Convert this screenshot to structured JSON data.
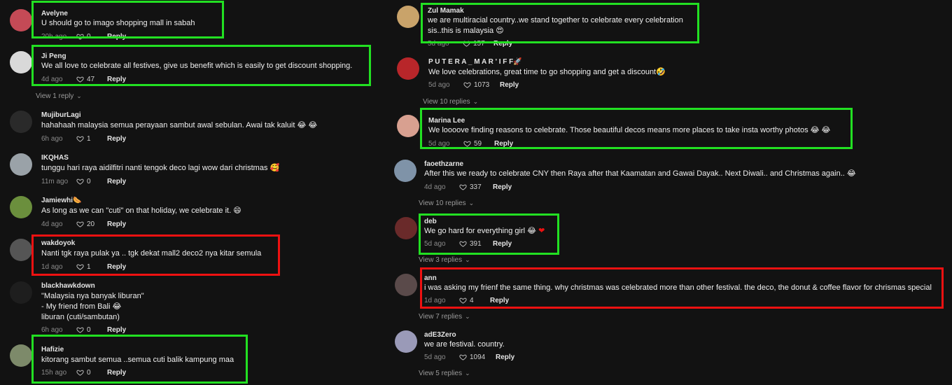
{
  "left": [
    {
      "user": "Avelyne",
      "text": "U should go to imago shopping mall in sabah",
      "time": "20h ago",
      "likes": "0",
      "reply": "Reply",
      "avatar": "#c44a56"
    },
    {
      "user": "Ji Peng",
      "text": "We all love to celebrate all festives, give us benefit which is easily to get discount shopping.",
      "time": "4d ago",
      "likes": "47",
      "reply": "Reply",
      "avatar": "#d9d9d9",
      "view": "View 1 reply"
    },
    {
      "user": "MujiburLagi",
      "text": "hahahaah malaysia semua perayaan sambut awal sebulan. Awai tak kaluit",
      "time": "6h ago",
      "likes": "1",
      "reply": "Reply",
      "avatar": "#2a2a2a",
      "emoji": "😂 😂"
    },
    {
      "user": "IKQHAS",
      "text": "tunggu hari raya aidilfitri nanti tengok deco lagi wow dari christmas",
      "time": "11m ago",
      "likes": "0",
      "reply": "Reply",
      "avatar": "#9aa2a8",
      "emoji": "🥰"
    },
    {
      "user": "Jamiewhi",
      "text": "As long as we can \"cuti\" on that holiday, we celebrate it.",
      "time": "4d ago",
      "likes": "20",
      "reply": "Reply",
      "avatar": "#6b8f3d",
      "emoji": "😄",
      "userEmoji": "🌭"
    },
    {
      "user": "wakdoyok",
      "text": "Nanti tgk raya pulak ya .. tgk dekat mall2 deco2 nya kitar semula",
      "time": "1d ago",
      "likes": "1",
      "reply": "Reply",
      "avatar": "#555555"
    },
    {
      "user": "blackhawkdown",
      "text1": "\"Malaysia nya banyak liburan\"",
      "text2": "- My friend from Bali",
      "text3": "liburan (cuti/sambutan)",
      "time": "6h ago",
      "likes": "0",
      "reply": "Reply",
      "avatar": "#1e1e1e",
      "emoji": "😂"
    },
    {
      "user": "Hafizie",
      "text": "kitorang sambut semua ..semua cuti balik kampung maa",
      "time": "15h ago",
      "likes": "0",
      "reply": "Reply",
      "avatar": "#7d8a6a"
    }
  ],
  "right": [
    {
      "user": "Zul Mamak",
      "text1": "we are multiracial country..we stand together to celebrate every celebration",
      "text2": "sis..this is malaysia",
      "time": "5d ago",
      "likes": "157",
      "reply": "Reply",
      "avatar": "#c9a36a",
      "emoji": "😍"
    },
    {
      "user": "P U T E R A _ M A R ' I F F",
      "userEmoji": "🚀",
      "text": "We love celebrations, great time to go shopping and get a discount",
      "time": "5d ago",
      "likes": "1073",
      "reply": "Reply",
      "avatar": "#b8262a",
      "emoji": "🤣",
      "view": "View 10 replies"
    },
    {
      "user": "Marina Lee",
      "text": "We loooove finding reasons to celebrate. Those beautiful decos means more places to take insta worthy photos",
      "time": "5d ago",
      "likes": "59",
      "reply": "Reply",
      "avatar": "#d8a090",
      "emoji": "😂 😂"
    },
    {
      "user": "faoethzarne",
      "text": "After this we ready to celebrate CNY then Raya after that Kaamatan and Gawai Dayak.. Next Diwali.. and Christmas again..",
      "time": "4d ago",
      "likes": "337",
      "reply": "Reply",
      "avatar": "#7f93a8",
      "emoji": "😂",
      "view": "View 10 replies"
    },
    {
      "user": "deb",
      "text": "We go hard for everything girl",
      "time": "5d ago",
      "likes": "391",
      "reply": "Reply",
      "avatar": "#6a2a2a",
      "emoji": "😂",
      "heart": "❤",
      "view": "View 3 replies"
    },
    {
      "user": "ann",
      "text": "i was asking my frienf the same thing. why christmas was celebrated more than other festival. the deco, the donut & coffee flavor for chrismas special",
      "time": "1d ago",
      "likes": "4",
      "reply": "Reply",
      "avatar": "#5a4a4a",
      "view": "View 7 replies"
    },
    {
      "user": "adE3Zero",
      "text": "we are festival. country.",
      "time": "5d ago",
      "likes": "1094",
      "reply": "Reply",
      "avatar": "#9a9ab8",
      "view": "View 5 replies"
    }
  ],
  "colors": {
    "highlight_good": "#22e022",
    "highlight_bad": "#ee1111",
    "bg": "#121212"
  }
}
